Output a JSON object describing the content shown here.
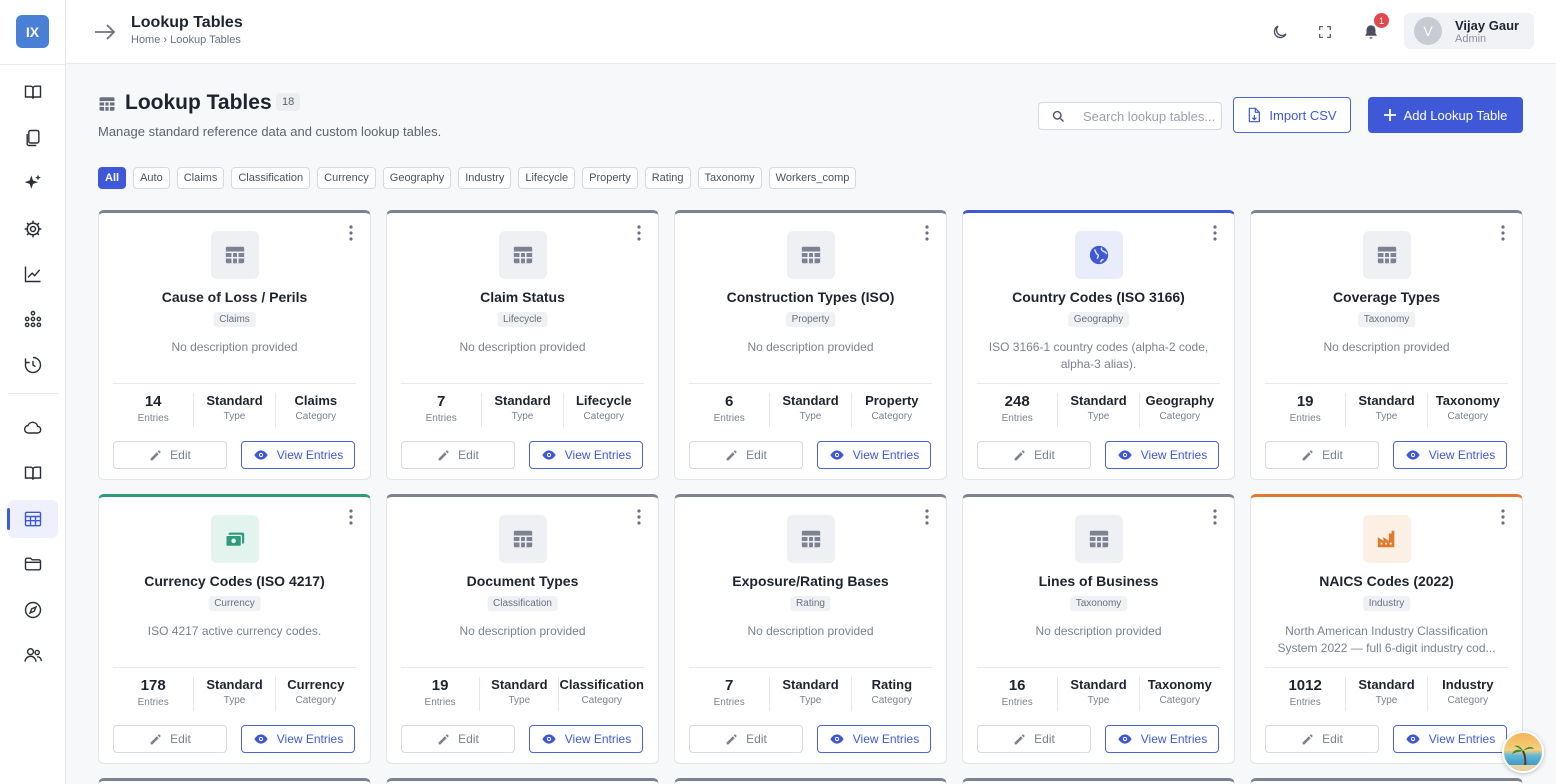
{
  "app": {
    "logo": "IX"
  },
  "header": {
    "title": "Lookup Tables",
    "breadcrumb": "Home › Lookup Tables",
    "notification_count": "1",
    "user": {
      "initial": "V",
      "name": "Vijay Gaur",
      "role": "Admin"
    }
  },
  "page": {
    "title": "Lookup Tables",
    "count": "18",
    "subtitle": "Manage standard reference data and custom lookup tables.",
    "search_placeholder": "Search lookup tables...",
    "import_label": "Import CSV",
    "add_label": "Add Lookup Table"
  },
  "filters": [
    "All",
    "Auto",
    "Claims",
    "Classification",
    "Currency",
    "Geography",
    "Industry",
    "Lifecycle",
    "Property",
    "Rating",
    "Taxonomy",
    "Workers_comp"
  ],
  "labels": {
    "entries": "Entries",
    "type": "Type",
    "category": "Category",
    "edit": "Edit",
    "view": "View Entries"
  },
  "colors": {
    "accent": "#3e58d8",
    "geography": "#3e58d8",
    "currency": "#2f9a7e",
    "industry": "#e07a2e",
    "default": "#7d8290"
  },
  "cards": [
    {
      "title": "Cause of Loss / Perils",
      "tag": "Claims",
      "desc": "No description provided",
      "entries": "14",
      "type": "Standard",
      "category": "Claims",
      "icon": "table-icon"
    },
    {
      "title": "Claim Status",
      "tag": "Lifecycle",
      "desc": "No description provided",
      "entries": "7",
      "type": "Standard",
      "category": "Lifecycle",
      "icon": "table-icon"
    },
    {
      "title": "Construction Types (ISO)",
      "tag": "Property",
      "desc": "No description provided",
      "entries": "6",
      "type": "Standard",
      "category": "Property",
      "icon": "table-icon"
    },
    {
      "title": "Country Codes (ISO 3166)",
      "tag": "Geography",
      "desc": "ISO 3166-1 country codes (alpha-2 code, alpha-3 alias).",
      "entries": "248",
      "type": "Standard",
      "category": "Geography",
      "icon": "globe-icon"
    },
    {
      "title": "Coverage Types",
      "tag": "Taxonomy",
      "desc": "No description provided",
      "entries": "19",
      "type": "Standard",
      "category": "Taxonomy",
      "icon": "table-icon"
    },
    {
      "title": "Currency Codes (ISO 4217)",
      "tag": "Currency",
      "desc": "ISO 4217 active currency codes.",
      "entries": "178",
      "type": "Standard",
      "category": "Currency",
      "icon": "money-icon"
    },
    {
      "title": "Document Types",
      "tag": "Classification",
      "desc": "No description provided",
      "entries": "19",
      "type": "Standard",
      "category": "Classification",
      "icon": "table-icon"
    },
    {
      "title": "Exposure/Rating Bases",
      "tag": "Rating",
      "desc": "No description provided",
      "entries": "7",
      "type": "Standard",
      "category": "Rating",
      "icon": "table-icon"
    },
    {
      "title": "Lines of Business",
      "tag": "Taxonomy",
      "desc": "No description provided",
      "entries": "16",
      "type": "Standard",
      "category": "Taxonomy",
      "icon": "table-icon"
    },
    {
      "title": "NAICS Codes (2022)",
      "tag": "Industry",
      "desc": "North American Industry Classification System 2022 — full 6-digit industry cod...",
      "entries": "1012",
      "type": "Standard",
      "category": "Industry",
      "icon": "factory-icon"
    }
  ]
}
